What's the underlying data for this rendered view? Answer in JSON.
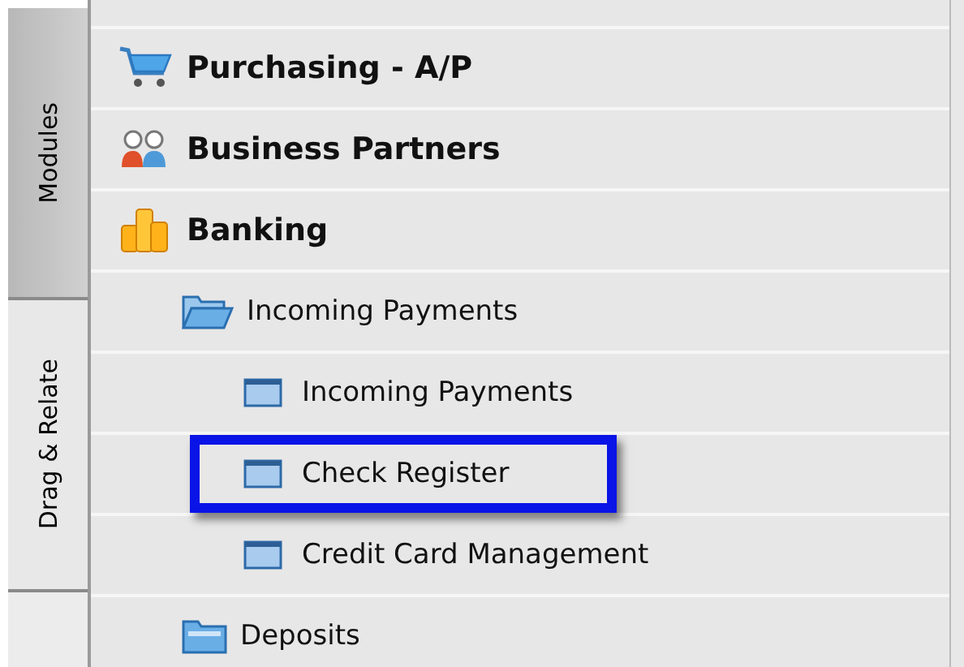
{
  "side_tabs": [
    {
      "label": "Modules",
      "selected": true
    },
    {
      "label": "Drag & Relate",
      "selected": false
    }
  ],
  "tree": [
    {
      "kind": "module",
      "label": "Purchasing - A/P"
    },
    {
      "kind": "module",
      "label": "Business Partners"
    },
    {
      "kind": "module",
      "label": "Banking",
      "children": [
        {
          "kind": "folder",
          "label": "Incoming Payments",
          "expanded": true,
          "children": [
            {
              "kind": "form",
              "label": "Incoming Payments",
              "highlighted": false
            },
            {
              "kind": "form",
              "label": "Check Register",
              "highlighted": true
            },
            {
              "kind": "form",
              "label": "Credit Card Management",
              "highlighted": false
            }
          ]
        },
        {
          "kind": "folder",
          "label": "Deposits",
          "expanded": false
        }
      ]
    }
  ]
}
